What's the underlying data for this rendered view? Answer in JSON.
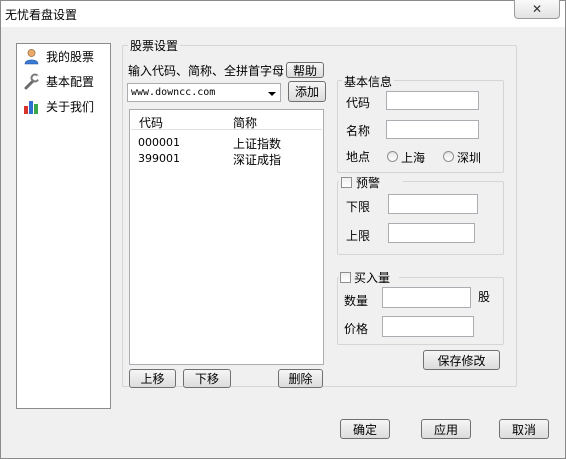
{
  "window": {
    "title": "无忧看盘设置",
    "close_label": "✕"
  },
  "nav": [
    {
      "label": "我的股票",
      "icon": "user-icon"
    },
    {
      "label": "基本配置",
      "icon": "wrench-icon"
    },
    {
      "label": "关于我们",
      "icon": "bar-chart-icon"
    }
  ],
  "stock_settings": {
    "group_title": "股票设置",
    "input_hint": "输入代码、简称、全拼首字母",
    "help_label": "帮助",
    "combo_value": "www.downcc.com",
    "add_label": "添加",
    "columns": [
      "代码",
      "简称"
    ],
    "rows": [
      {
        "code": "000001",
        "name": "上证指数"
      },
      {
        "code": "399001",
        "name": "深证成指"
      }
    ],
    "move_up_label": "上移",
    "move_down_label": "下移",
    "delete_label": "删除"
  },
  "basic_info": {
    "group_title": "基本信息",
    "code_label": "代码",
    "name_label": "名称",
    "location_label": "地点",
    "option_shanghai": "上海",
    "option_shenzhen": "深圳"
  },
  "alert": {
    "group_title": "预警",
    "lower_label": "下限",
    "upper_label": "上限"
  },
  "buy": {
    "group_title": "买入量",
    "qty_label": "数量",
    "unit_label": "股",
    "price_label": "价格"
  },
  "save_label": "保存修改",
  "footer": {
    "ok_label": "确定",
    "apply_label": "应用",
    "cancel_label": "取消"
  }
}
